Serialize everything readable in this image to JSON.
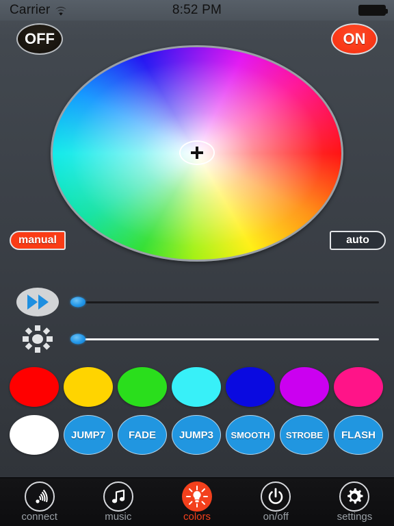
{
  "statusbar": {
    "carrier": "Carrier",
    "time": "8:52 PM",
    "wifi_icon": "wifi-icon",
    "battery_icon": "battery-full-icon"
  },
  "power": {
    "off_label": "OFF",
    "on_label": "ON",
    "off_color": "#120f0b",
    "on_color": "#f52f10"
  },
  "wheel": {
    "name": "color-wheel",
    "cursor_icon": "crosshair-plus-icon"
  },
  "mode": {
    "manual_label": "manual",
    "auto_label": "auto",
    "manual_active": true,
    "manual_color": "#fa3c16",
    "auto_color": "#2b3038"
  },
  "sliders": [
    {
      "name": "speed",
      "icon": "fast-forward-icon",
      "value": 0,
      "track_color": "#1a1a1c"
    },
    {
      "name": "brightness",
      "icon": "sun-icon",
      "value": 0,
      "track_color": "#f0f2f4"
    }
  ],
  "color_presets": [
    {
      "label": "red",
      "color": "#ff0000"
    },
    {
      "label": "yellow",
      "color": "#ffd400"
    },
    {
      "label": "green",
      "color": "#2ade1c"
    },
    {
      "label": "cyan",
      "color": "#38f0f8"
    },
    {
      "label": "blue",
      "color": "#0a0ae0"
    },
    {
      "label": "purple",
      "color": "#cb00f0"
    },
    {
      "label": "pink",
      "color": "#ff1488"
    }
  ],
  "effects": [
    {
      "label": "",
      "color": "#ffffff",
      "type": "color"
    },
    {
      "label": "JUMP7",
      "color": "#2196e0",
      "type": "effect"
    },
    {
      "label": "FADE",
      "color": "#2196e0",
      "type": "effect"
    },
    {
      "label": "JUMP3",
      "color": "#2196e0",
      "type": "effect"
    },
    {
      "label": "SMOOTH",
      "color": "#2196e0",
      "type": "effect"
    },
    {
      "label": "STROBE",
      "color": "#2196e0",
      "type": "effect"
    },
    {
      "label": "FLASH",
      "color": "#2196e0",
      "type": "effect"
    }
  ],
  "tabs": [
    {
      "label": "connect",
      "icon": "signal-waves-icon",
      "active": false
    },
    {
      "label": "music",
      "icon": "music-note-icon",
      "active": false
    },
    {
      "label": "colors",
      "icon": "light-bulb-icon",
      "active": true
    },
    {
      "label": "on/off",
      "icon": "power-icon",
      "active": false
    },
    {
      "label": "settings",
      "icon": "gear-icon",
      "active": false
    }
  ],
  "accent_color": "#f3401c"
}
